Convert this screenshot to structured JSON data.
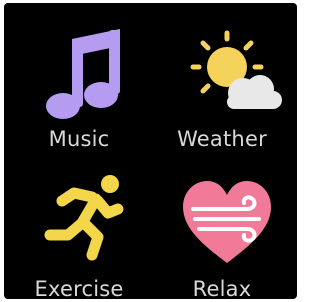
{
  "apps": {
    "music": {
      "label": "Music",
      "icon": "music-note-icon",
      "color": "#b59cf0"
    },
    "weather": {
      "label": "Weather",
      "icon": "partly-cloudy-icon",
      "color": "#f5d35a"
    },
    "exercise": {
      "label": "Exercise",
      "icon": "running-person-icon",
      "color": "#f3d64a"
    },
    "relax": {
      "label": "Relax",
      "icon": "heart-wind-icon",
      "color": "#f17a98"
    }
  }
}
